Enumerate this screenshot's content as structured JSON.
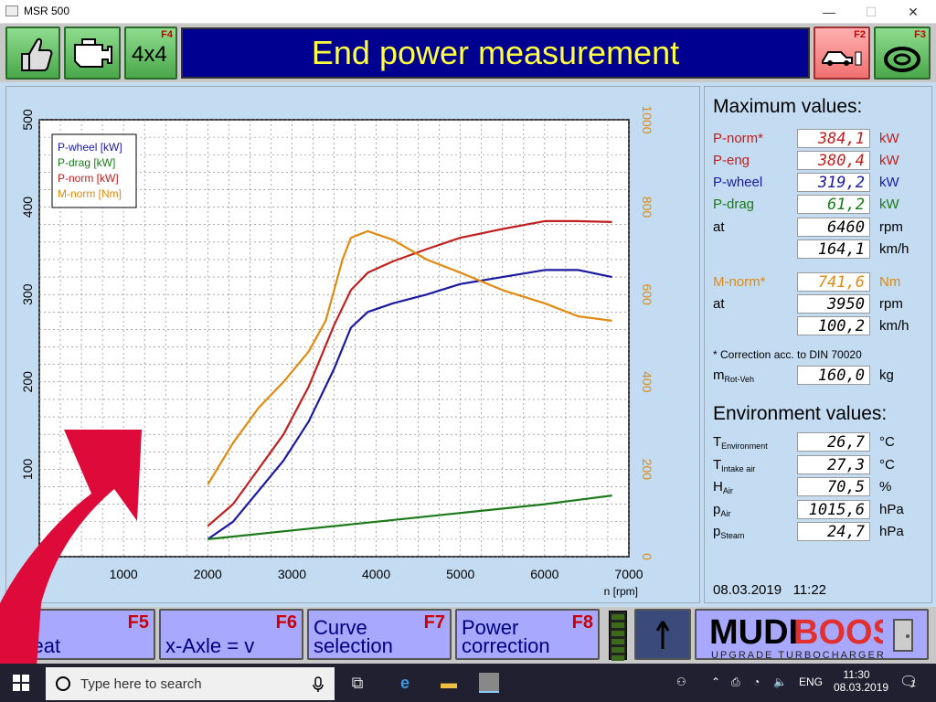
{
  "window": {
    "title": "MSR 500",
    "minimize": "—",
    "maximize": "☐",
    "close": "✕"
  },
  "toolbar": {
    "f4_key": "F4",
    "f4_label": "4x4",
    "headline": "End power measurement",
    "f2_key": "F2",
    "f3_key": "F3"
  },
  "chart_data": {
    "type": "line",
    "xlabel": "n [rpm]",
    "xlim": [
      0,
      7000
    ],
    "ylim_left": [
      0,
      500
    ],
    "ylim_right": [
      0,
      1000
    ],
    "x_ticks": [
      "1000",
      "2000",
      "3000",
      "4000",
      "5000",
      "6000",
      "7000"
    ],
    "y_left_ticks": [
      "100",
      "200",
      "300",
      "400",
      "500"
    ],
    "y_right_ticks": [
      "0",
      "200",
      "400",
      "600",
      "800",
      "1000"
    ],
    "legend": [
      "P-wheel [kW]",
      "P-drag [kW]",
      "P-norm [kW]",
      "M-norm [Nm]"
    ],
    "series": [
      {
        "name": "P-wheel [kW]",
        "color": "#1a1aa0",
        "axis": "left",
        "x": [
          2000,
          2300,
          2600,
          2900,
          3200,
          3500,
          3700,
          3900,
          4200,
          4600,
          5000,
          5500,
          6000,
          6400,
          6800
        ],
        "y": [
          20,
          40,
          75,
          110,
          155,
          215,
          262,
          280,
          290,
          300,
          312,
          320,
          328,
          328,
          320
        ]
      },
      {
        "name": "P-drag [kW]",
        "color": "#1a7a1a",
        "axis": "left",
        "x": [
          2000,
          3000,
          4000,
          5000,
          6000,
          6800
        ],
        "y": [
          20,
          30,
          40,
          50,
          60,
          70
        ]
      },
      {
        "name": "P-norm [kW]",
        "color": "#c02020",
        "axis": "left",
        "x": [
          2000,
          2300,
          2600,
          2900,
          3200,
          3500,
          3700,
          3900,
          4200,
          4600,
          5000,
          5500,
          6000,
          6400,
          6800
        ],
        "y": [
          35,
          60,
          100,
          140,
          195,
          265,
          305,
          325,
          338,
          352,
          365,
          375,
          384,
          384,
          383
        ]
      },
      {
        "name": "M-norm [Nm]",
        "color": "#e08a10",
        "axis": "right",
        "x": [
          2000,
          2300,
          2600,
          2900,
          3200,
          3400,
          3600,
          3700,
          3900,
          4200,
          4600,
          5000,
          5500,
          6000,
          6400,
          6800
        ],
        "y": [
          165,
          260,
          340,
          400,
          470,
          540,
          680,
          730,
          745,
          725,
          680,
          650,
          610,
          580,
          550,
          540
        ]
      }
    ]
  },
  "max_values": {
    "heading": "Maximum values:",
    "p_norm_label": "P-norm*",
    "p_norm": "384,1",
    "p_norm_unit": "kW",
    "p_eng_label": "P-eng",
    "p_eng": "380,4",
    "p_eng_unit": "kW",
    "p_wheel_label": "P-wheel",
    "p_wheel": "319,2",
    "p_wheel_unit": "kW",
    "p_drag_label": "P-drag",
    "p_drag": "61,2",
    "p_drag_unit": "kW",
    "at1_label": "at",
    "at1_rpm": "6460",
    "rpm_unit": "rpm",
    "at1_speed": "164,1",
    "kmh_unit": "km/h",
    "m_norm_label": "M-norm*",
    "m_norm": "741,6",
    "m_norm_unit": "Nm",
    "at2_label": "at",
    "at2_rpm": "3950",
    "at2_speed": "100,2",
    "correction_note": "* Correction acc. to DIN 70020",
    "m_rot_label": "m",
    "m_rot_sub": "Rot-Veh",
    "m_rot": "160,0",
    "m_rot_unit": "kg"
  },
  "environment": {
    "heading": "Environment values:",
    "t_env_sub": "Environment",
    "t_env": "26,7",
    "t_env_unit": "°C",
    "t_intake_sub": "Intake air",
    "t_intake": "27,3",
    "t_intake_unit": "°C",
    "h_air_sub": "Air",
    "h_air": "70,5",
    "h_air_unit": "%",
    "p_air_sub": "Air",
    "p_air": "1015,6",
    "p_air_unit": "hPa",
    "p_steam_sub": "Steam",
    "p_steam": "24,7",
    "p_steam_unit": "hPa",
    "date": "08.03.2019",
    "time": "11:22"
  },
  "fkeys": {
    "f5_key": "F5",
    "f5_label": "epeat",
    "f6_key": "F6",
    "f6_label": "x-Axle = v",
    "f7_key": "F7",
    "f7_label": "Curve selection",
    "f8_key": "F8",
    "f8_label": "Power correction"
  },
  "watermark": {
    "brand": "MUDI BOOST",
    "tagline": "UPGRADE TURBOCHARGERS"
  },
  "taskbar": {
    "search_placeholder": "Type here to search",
    "lang": "ENG",
    "time": "11:30",
    "date": "08.03.2019",
    "notif_count": "1"
  }
}
